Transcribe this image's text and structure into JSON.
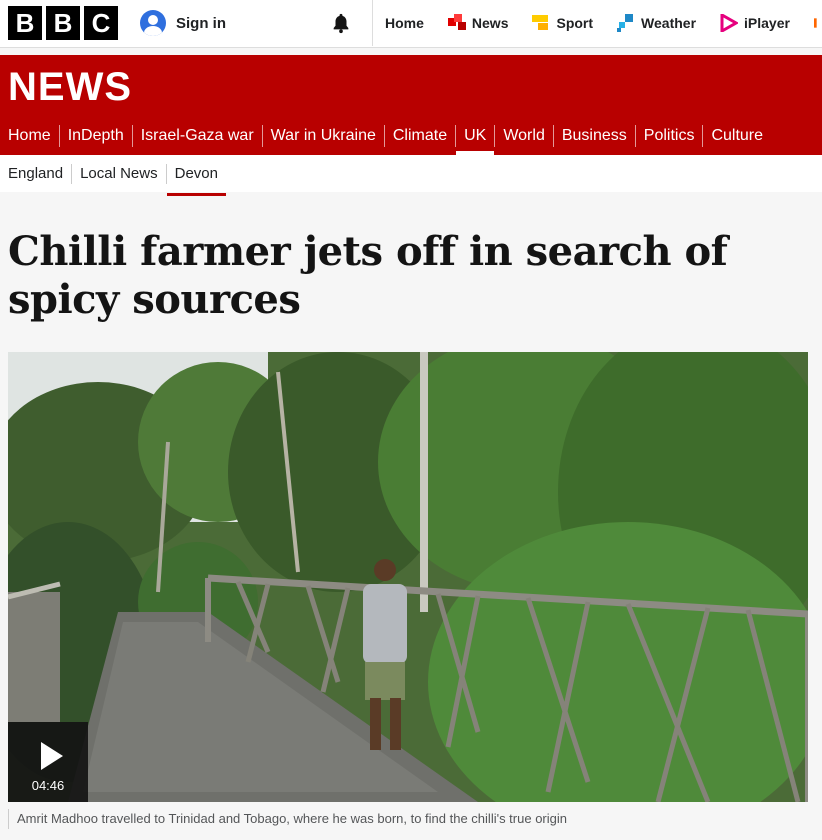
{
  "brand": {
    "letters": [
      "B",
      "B",
      "C"
    ]
  },
  "account": {
    "signin_label": "Sign in"
  },
  "top_nav": [
    {
      "label": "Home",
      "icon": "none"
    },
    {
      "label": "News",
      "icon": "news-icon",
      "color": "#e00000"
    },
    {
      "label": "Sport",
      "icon": "sport-icon",
      "color": "#ffcc00"
    },
    {
      "label": "Weather",
      "icon": "weather-icon",
      "color": "#1e88c7"
    },
    {
      "label": "iPlayer",
      "icon": "iplayer-icon",
      "color": "#e6007e"
    }
  ],
  "section": {
    "title": "NEWS",
    "color": "#b80000"
  },
  "main_nav": [
    "Home",
    "InDepth",
    "Israel-Gaza war",
    "War in Ukraine",
    "Climate",
    "UK",
    "World",
    "Business",
    "Politics",
    "Culture"
  ],
  "main_nav_active": "UK",
  "sub_nav": [
    "England",
    "Local News",
    "Devon"
  ],
  "sub_nav_active": "Devon",
  "article": {
    "headline": "Chilli farmer jets off in search of spicy sources",
    "video_duration": "04:46",
    "caption": "Amrit Madhoo travelled to Trinidad and Tobago, where he was born, to find the chilli's true origin"
  }
}
